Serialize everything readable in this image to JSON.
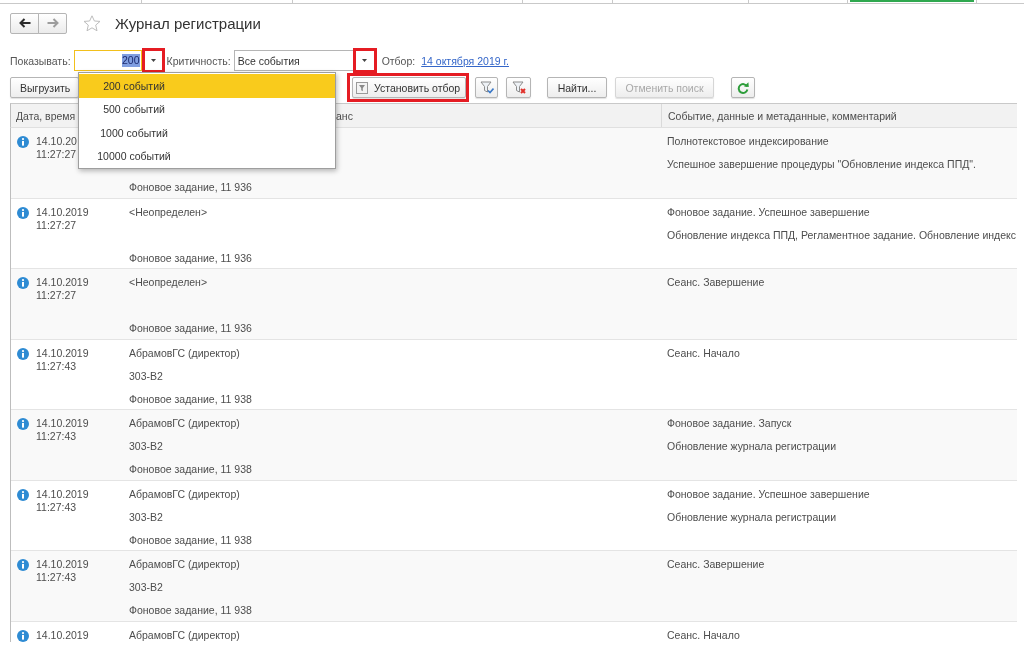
{
  "top_tabs": [
    {
      "selected": false
    },
    {
      "selected": false
    },
    {
      "selected": false
    },
    {
      "selected": false
    },
    {
      "selected": false
    },
    {
      "selected": false
    },
    {
      "selected": true
    }
  ],
  "navigation": {
    "back": {
      "disabled": false
    },
    "forward": {
      "disabled": true
    }
  },
  "window": {
    "title": "Журнал регистрации",
    "starred": false
  },
  "filters": {
    "show": {
      "label": "Показывать:",
      "value": "200",
      "focused": true,
      "text_selected": true,
      "highlighted": true
    },
    "severity": {
      "label": "Критичность:",
      "value": "Все события",
      "highlighted": true
    },
    "selection": {
      "label": "Отбор:",
      "link": "14 октября 2019 г."
    }
  },
  "show_options": [
    {
      "label": "200 событий",
      "selected": true
    },
    {
      "label": "500 событий",
      "selected": false
    },
    {
      "label": "1000 событий",
      "selected": false
    },
    {
      "label": "10000 событий",
      "selected": false
    }
  ],
  "toolbar": {
    "export": {
      "label": "Выгрузить",
      "disabled": false,
      "highlighted": false
    },
    "set_filter": {
      "label": "Установить отбор",
      "disabled": false,
      "highlighted": true
    },
    "find": {
      "label": "Найти...",
      "disabled": false,
      "highlighted": false
    },
    "cancel_search": {
      "label": "Отменить поиск",
      "disabled": true,
      "highlighted": false
    }
  },
  "table": {
    "columns": [
      {
        "label": "Дата, время"
      },
      {
        "label": "анс"
      },
      {
        "label": "Событие, данные и метаданные, комментарий"
      }
    ],
    "rows": [
      {
        "date": "14.10.20",
        "time": "11:27:27",
        "session": "Фоновое задание, 11 936",
        "event": "Полнотекстовое индексирование",
        "details": "Успешное завершение процедуры \"Обновление индекса ППД\"."
      },
      {
        "date": "14.10.2019",
        "time": "11:27:27",
        "user": "<Неопределен>",
        "session": "Фоновое задание, 11 936",
        "event": "Фоновое задание. Успешное завершение",
        "details": "Обновление индекса ППД, Регламентное задание. Обновление индекс"
      },
      {
        "date": "14.10.2019",
        "time": "11:27:27",
        "user": "<Неопределен>",
        "session": "Фоновое задание, 11 936",
        "event": "Сеанс. Завершение"
      },
      {
        "date": "14.10.2019",
        "time": "11:27:43",
        "user": "АбрамовГС (директор)",
        "computer": "303-В2",
        "session": "Фоновое задание, 11 938",
        "event": "Сеанс. Начало"
      },
      {
        "date": "14.10.2019",
        "time": "11:27:43",
        "user": "АбрамовГС (директор)",
        "computer": "303-В2",
        "session": "Фоновое задание, 11 938",
        "event": "Фоновое задание. Запуск",
        "details": "Обновление журнала регистрации"
      },
      {
        "date": "14.10.2019",
        "time": "11:27:43",
        "user": "АбрамовГС (директор)",
        "computer": "303-В2",
        "session": "Фоновое задание, 11 938",
        "event": "Фоновое задание. Успешное завершение",
        "details": "Обновление журнала регистрации"
      },
      {
        "date": "14.10.2019",
        "time": "11:27:43",
        "user": "АбрамовГС (директор)",
        "computer": "303-В2",
        "session": "Фоновое задание, 11 938",
        "event": "Сеанс. Завершение"
      },
      {
        "date": "14.10.2019",
        "user": "АбрамовГС (директор)",
        "event": "Сеанс. Начало"
      }
    ]
  }
}
